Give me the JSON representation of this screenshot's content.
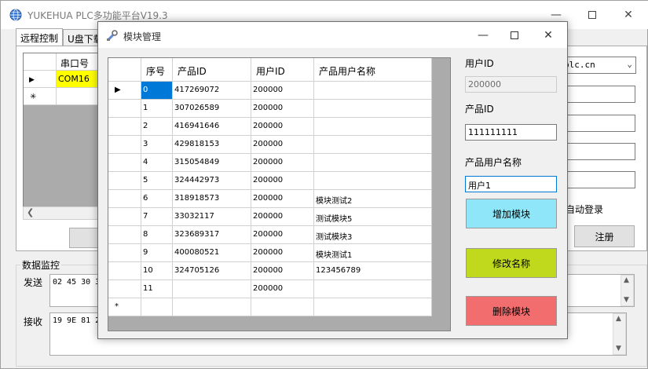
{
  "window": {
    "title": "YUKEHUA PLC多功能平台V19.3"
  },
  "tabs": [
    {
      "label": "远程控制"
    },
    {
      "label": "U盘下载"
    }
  ],
  "serial_grid": {
    "column_header": "串口号",
    "rows": [
      "COM16"
    ]
  },
  "right_panel": {
    "server_combo_value": "plc.cn",
    "auto_login_label": "自动登录",
    "register_button": "注册"
  },
  "monitor": {
    "title": "数据监控",
    "send_label": "发送",
    "send_value": "02 45 30 3",
    "receive_label": "接收",
    "receive_value": "19 9E 81 2"
  },
  "dialog": {
    "title": "模块管理",
    "columns": [
      "序号",
      "产品ID",
      "用户ID",
      "产品用户名称"
    ],
    "rows": [
      [
        "0",
        "417269072",
        "200000",
        ""
      ],
      [
        "1",
        "307026589",
        "200000",
        ""
      ],
      [
        "2",
        "416941646",
        "200000",
        ""
      ],
      [
        "3",
        "429818153",
        "200000",
        ""
      ],
      [
        "4",
        "315054849",
        "200000",
        ""
      ],
      [
        "5",
        "324442973",
        "200000",
        ""
      ],
      [
        "6",
        "318918573",
        "200000",
        "模块测试2"
      ],
      [
        "7",
        "33032117",
        "200000",
        "测试模块5"
      ],
      [
        "8",
        "323689317",
        "200000",
        "测试模块3"
      ],
      [
        "9",
        "400080521",
        "200000",
        "模块测试1"
      ],
      [
        "10",
        "324705126",
        "200000",
        "123456789"
      ],
      [
        "11",
        "",
        "200000",
        ""
      ]
    ],
    "new_row_marker": "*",
    "current_row_marker": "▶",
    "user_id_label": "用户ID",
    "user_id_value": "200000",
    "product_id_label": "产品ID",
    "product_id_value": "111111111",
    "product_user_name_label": "产品用户名称",
    "product_user_name_value": "用户1",
    "add_button": "增加模块",
    "rename_button": "修改名称",
    "delete_button": "删除模块",
    "colors": {
      "add": "#8fe6f8",
      "rename": "#c0d91c",
      "delete": "#f26d6d",
      "selection": "#0078d7",
      "serial_highlight": "#ffff00"
    }
  }
}
